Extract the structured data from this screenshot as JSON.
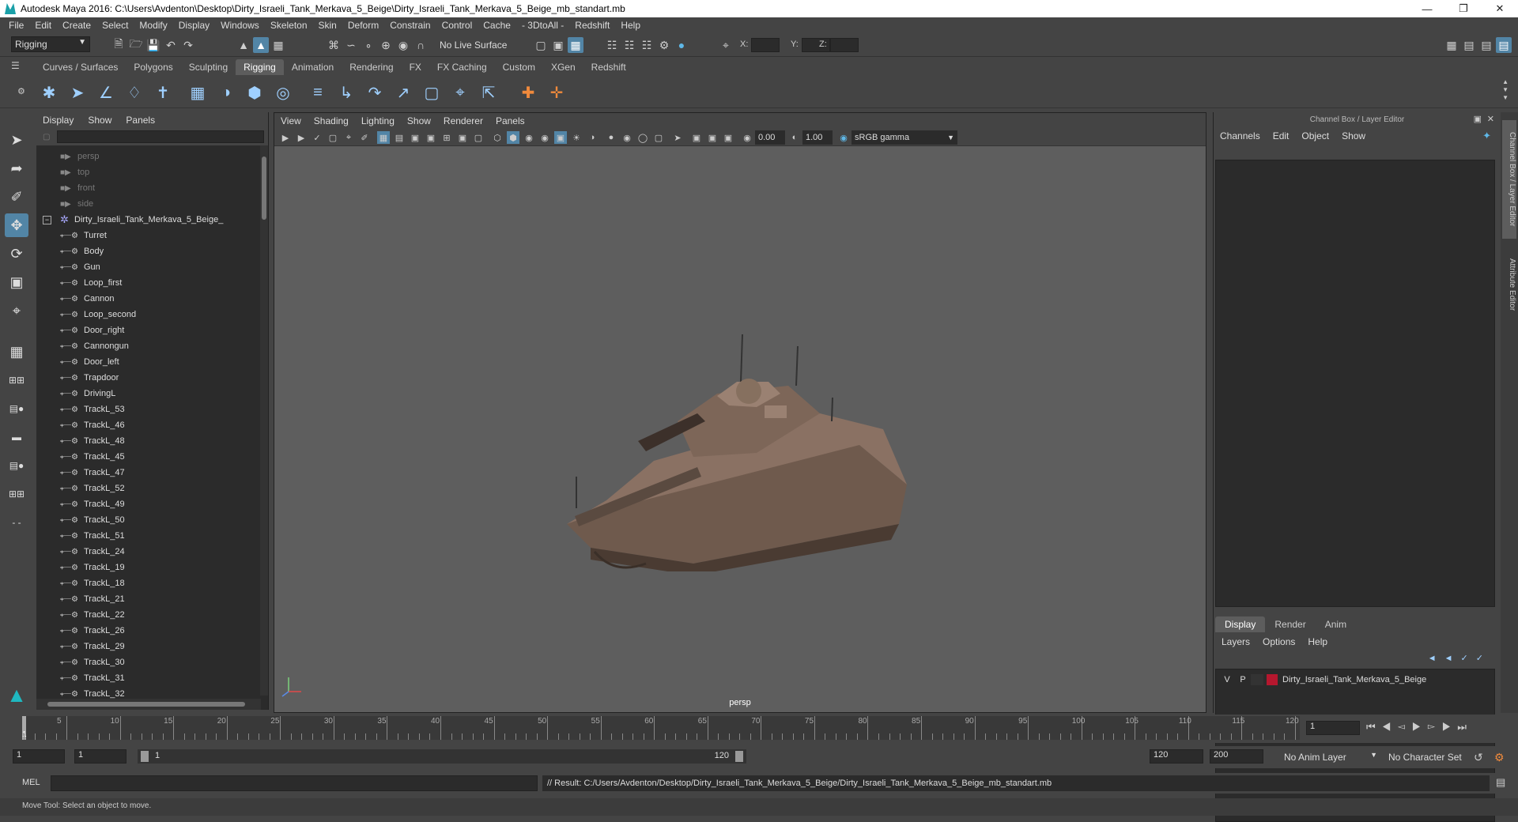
{
  "window": {
    "title": "Autodesk Maya 2016: C:\\Users\\Avdenton\\Desktop\\Dirty_Israeli_Tank_Merkava_5_Beige\\Dirty_Israeli_Tank_Merkava_5_Beige_mb_standart.mb"
  },
  "menubar": [
    "File",
    "Edit",
    "Create",
    "Select",
    "Modify",
    "Display",
    "Windows",
    "Skeleton",
    "Skin",
    "Deform",
    "Constrain",
    "Control",
    "Cache",
    "- 3DtoAll -",
    "Redshift",
    "Help"
  ],
  "statusline": {
    "mode": "Rigging",
    "live_surface": "No Live Surface",
    "x_label": "X:",
    "y_label": "Y:",
    "z_label": "Z:"
  },
  "shelf_tabs": [
    "Curves / Surfaces",
    "Polygons",
    "Sculpting",
    "Rigging",
    "Animation",
    "Rendering",
    "FX",
    "FX Caching",
    "Custom",
    "XGen",
    "Redshift"
  ],
  "shelf_active": "Rigging",
  "outliner": {
    "menu": [
      "Display",
      "Show",
      "Panels"
    ],
    "cameras": [
      "persp",
      "top",
      "front",
      "side"
    ],
    "root": "Dirty_Israeli_Tank_Merkava_5_Beige_",
    "children": [
      "Turret",
      "Body",
      "Gun",
      "Loop_first",
      "Cannon",
      "Loop_second",
      "Door_right",
      "Cannongun",
      "Door_left",
      "Trapdoor",
      "DrivingL",
      "TrackL_53",
      "TrackL_46",
      "TrackL_48",
      "TrackL_45",
      "TrackL_47",
      "TrackL_52",
      "TrackL_49",
      "TrackL_50",
      "TrackL_51",
      "TrackL_24",
      "TrackL_19",
      "TrackL_18",
      "TrackL_21",
      "TrackL_22",
      "TrackL_26",
      "TrackL_29",
      "TrackL_30",
      "TrackL_31",
      "TrackL_32"
    ]
  },
  "viewport": {
    "menu": [
      "View",
      "Shading",
      "Lighting",
      "Show",
      "Renderer",
      "Panels"
    ],
    "exposure": "0.00",
    "gamma": "1.00",
    "colorspace": "sRGB gamma",
    "camera": "persp"
  },
  "channelbox": {
    "header": "Channel Box / Layer Editor",
    "menu": [
      "Channels",
      "Edit",
      "Object",
      "Show"
    ],
    "layer_tabs": [
      "Display",
      "Render",
      "Anim"
    ],
    "layer_tab_active": "Display",
    "layer_menu": [
      "Layers",
      "Options",
      "Help"
    ],
    "layer": {
      "v": "V",
      "p": "P",
      "name": "Dirty_Israeli_Tank_Merkava_5_Beige",
      "color": "#b5172e"
    }
  },
  "side_tabs": [
    "Channel Box / Layer Editor",
    "Attribute Editor"
  ],
  "timeline": {
    "ticks": [
      "1",
      "5",
      "10",
      "15",
      "20",
      "25",
      "30",
      "35",
      "40",
      "45",
      "50",
      "55",
      "60",
      "65",
      "70",
      "75",
      "80",
      "85",
      "90",
      "95",
      "100",
      "105",
      "110",
      "115",
      "120"
    ],
    "current": "1"
  },
  "range": {
    "start": "1",
    "playback_start": "1",
    "slider_start": "1",
    "slider_end": "120",
    "playback_end": "120",
    "end": "200",
    "anim_layer": "No Anim Layer",
    "character_set": "No Character Set"
  },
  "cmd": {
    "label": "MEL",
    "result": "// Result: C:/Users/Avdenton/Desktop/Dirty_Israeli_Tank_Merkava_5_Beige/Dirty_Israeli_Tank_Merkava_5_Beige_mb_standart.mb"
  },
  "helpline": "Move Tool: Select an object to move.",
  "colors": {
    "accent": "#5285a6",
    "panel": "#444444",
    "field": "#2b2b2b",
    "viewport_bg": "#5e5e5e"
  }
}
